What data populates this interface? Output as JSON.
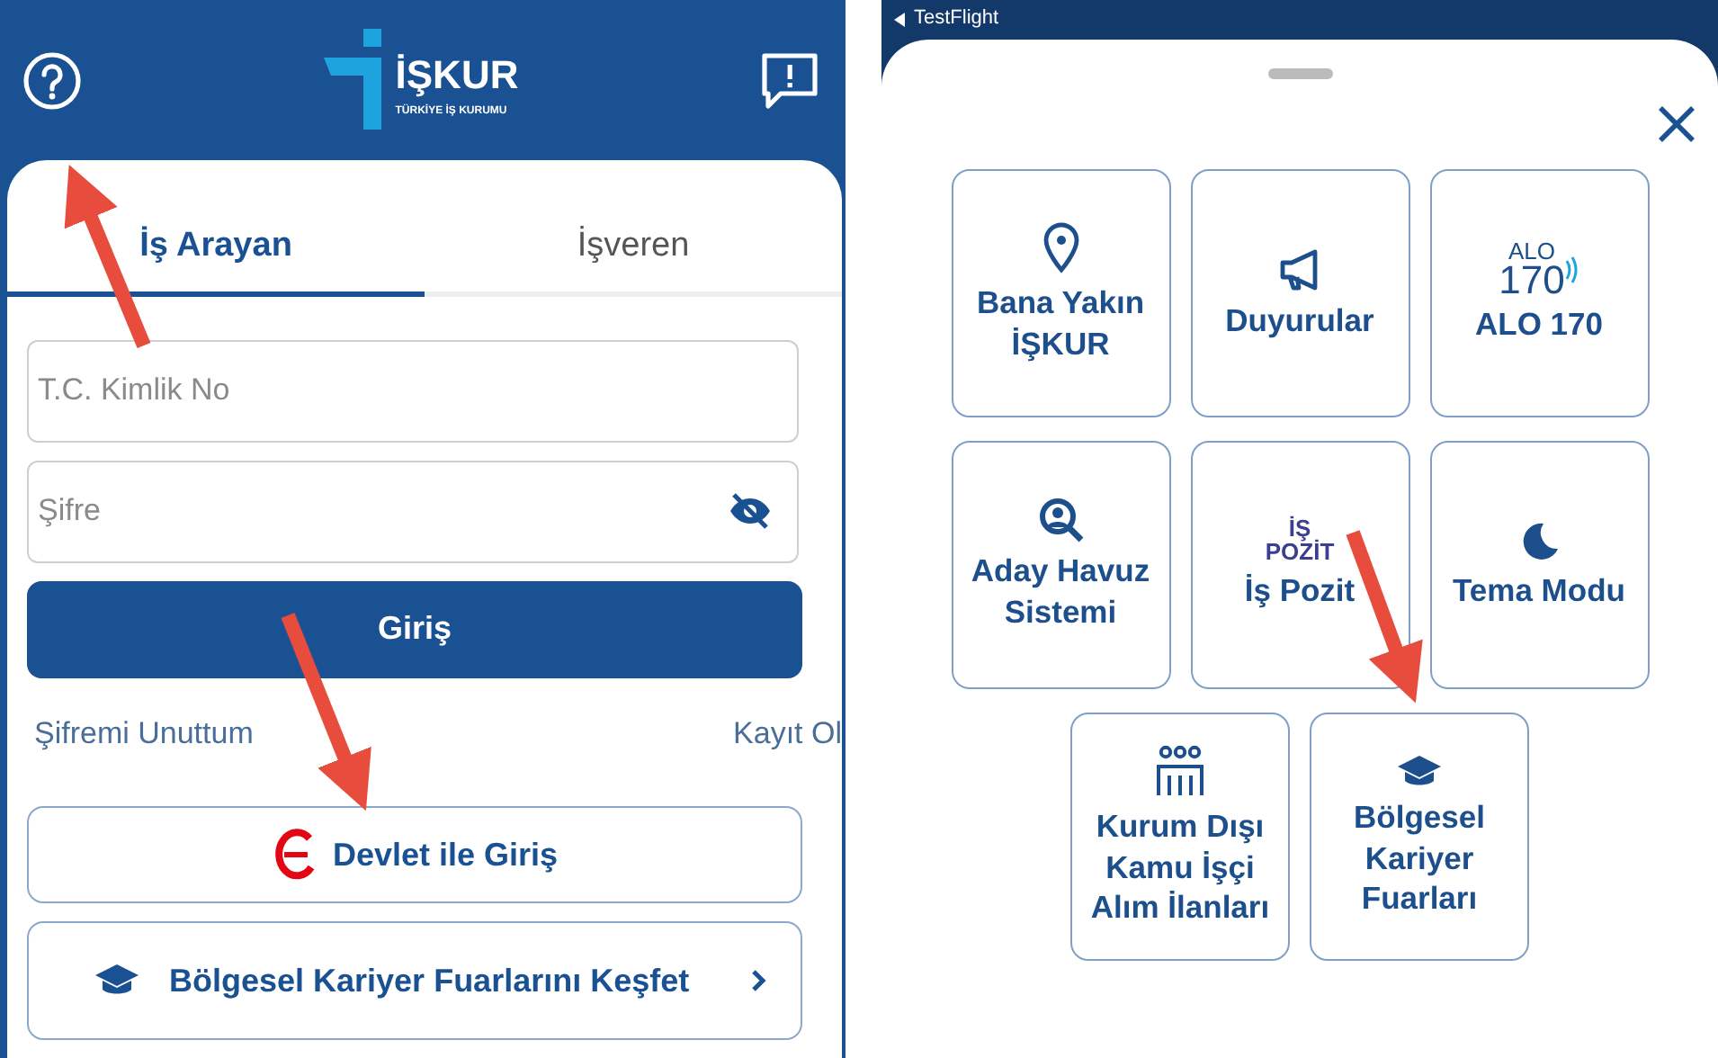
{
  "left_screen": {
    "header": {
      "logo_title": "İŞKUR",
      "logo_subtitle": "TÜRKİYE İŞ KURUMU"
    },
    "tabs": [
      {
        "label": "İş Arayan",
        "selected": true
      },
      {
        "label": "İşveren",
        "selected": false
      }
    ],
    "fields": [
      {
        "kind": "text",
        "placeholder": "T.C. Kimlik No"
      },
      {
        "kind": "password",
        "placeholder": "Şifre"
      }
    ],
    "login_button": "Giriş",
    "links": [
      "Şifremi Unuttum",
      "Kayıt Ol"
    ],
    "edevlet_button": "Devlet ile Giriş",
    "explore_button": "Bölgesel Kariyer Fuarlarını Keşfet"
  },
  "right_screen": {
    "status_bar": {
      "back_label": "TestFlight"
    },
    "tile_rows": [
      [
        {
          "kind": "pin",
          "label": [
            "Bana Yakın",
            "İŞKUR"
          ]
        },
        {
          "kind": "megaphone",
          "label": [
            "Duyurular"
          ]
        },
        {
          "kind": "alo",
          "icon_text": [
            "ALO",
            "170"
          ],
          "label": [
            "ALO 170"
          ]
        }
      ],
      [
        {
          "kind": "search",
          "label": [
            "Aday Havuz",
            "Sistemi"
          ]
        },
        {
          "kind": "logo",
          "icon_text": [
            "İŞ",
            "POZİT"
          ],
          "label": [
            "İş Pozit"
          ]
        },
        {
          "kind": "moon",
          "label": [
            "Tema Modu"
          ]
        }
      ],
      [
        {
          "kind": "people",
          "label": [
            "Kurum Dışı",
            "Kamu İşçi",
            "Alım İlanları"
          ]
        },
        {
          "kind": "cap",
          "label": [
            "Bölgesel",
            "Kariyer",
            "Fuarları"
          ]
        }
      ]
    ]
  }
}
